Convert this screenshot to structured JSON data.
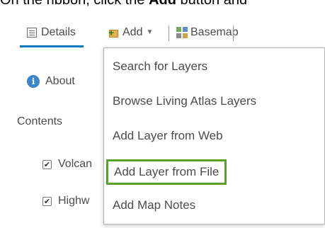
{
  "instruction": {
    "before": "On the ribbon, click the ",
    "bold": "Add",
    "after": " button and"
  },
  "toolbar": {
    "details_label": "Details",
    "add_label": "Add",
    "basemap_label": "Basemap"
  },
  "panel": {
    "about_label": "About",
    "contents_label": "Contents",
    "layers": [
      {
        "label": "Volcan",
        "checked": true
      },
      {
        "label": "Highw",
        "checked": true
      }
    ]
  },
  "add_menu": {
    "items": [
      {
        "label": "Search for Layers",
        "highlighted": false
      },
      {
        "label": "Browse Living Atlas Layers",
        "highlighted": false
      },
      {
        "label": "Add Layer from Web",
        "highlighted": false
      },
      {
        "label": "Add Layer from File",
        "highlighted": true
      },
      {
        "label": "Add Map Notes",
        "highlighted": false
      }
    ]
  },
  "colors": {
    "active_tab_underline": "#0079c1",
    "highlight_border": "#5aa02c",
    "info_icon": "#3a86c8"
  },
  "icons": {
    "details": "details-icon",
    "add": "add-icon",
    "add_caret": "caret-down-icon",
    "basemap": "basemap-icon",
    "about": "info-icon",
    "checkbox": "checkbox-checked-icon"
  }
}
